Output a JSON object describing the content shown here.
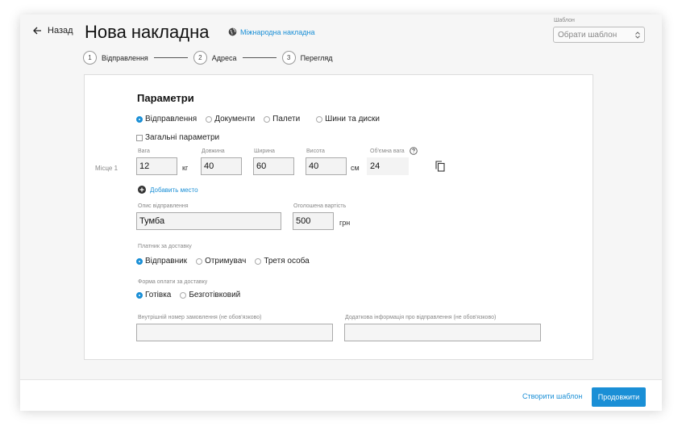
{
  "header": {
    "back_label": "Назад",
    "title": "Нова накладна",
    "intl_link": "Міжнародна накладна",
    "template_label": "Шаблон",
    "template_placeholder": "Обрати шаблон"
  },
  "steps": [
    {
      "num": "1",
      "label": "Відправлення"
    },
    {
      "num": "2",
      "label": "Адреса"
    },
    {
      "num": "3",
      "label": "Перегляд"
    }
  ],
  "params": {
    "title": "Параметри",
    "types": [
      "Відправлення",
      "Документи",
      "Палети",
      "Шини та диски"
    ],
    "selected_type": 0,
    "general_params": "Загальні параметри",
    "place_label": "Місце 1",
    "fields": {
      "weight_label": "Вага",
      "weight": "12",
      "weight_unit": "кг",
      "length_label": "Довжина",
      "length": "40",
      "width_label": "Ширина",
      "width": "60",
      "height_label": "Висота",
      "height": "40",
      "size_unit": "см",
      "volume_label": "Об'ємна вага",
      "volume": "24"
    },
    "add_place": "Добавить место",
    "desc_label": "Опис відправлення",
    "desc": "Тумба",
    "declared_label": "Оголошена вартість",
    "declared": "500",
    "declared_unit": "грн"
  },
  "payer": {
    "label": "Платник за доставку",
    "options": [
      "Відправник",
      "Отримувач",
      "Третя особа"
    ],
    "selected": 0
  },
  "payment": {
    "label": "Форма оплати за доставку",
    "options": [
      "Готівка",
      "Безготівковий"
    ],
    "selected": 0
  },
  "extra": {
    "order_label": "Внутрішній номер замовлення (не обов'язково)",
    "info_label": "Додаткова інформація про відправлення (не обов'язково)"
  },
  "footer": {
    "create_template": "Створити шаблон",
    "continue": "Продовжити"
  },
  "colors": {
    "accent": "#1a8fd6"
  }
}
